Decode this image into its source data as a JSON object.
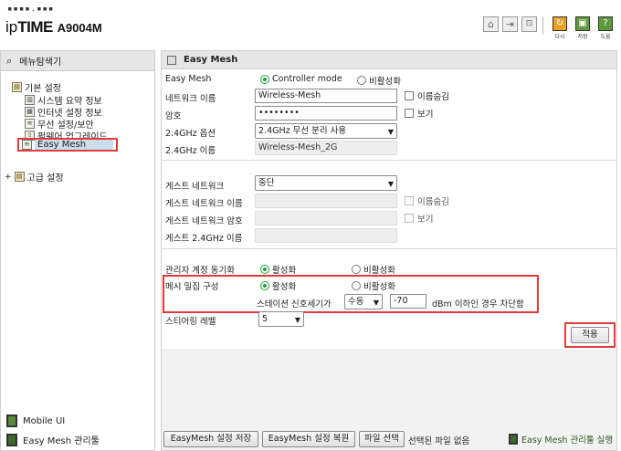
{
  "header": {
    "logo_dots": "▪▪▪▪.▪▪▪",
    "logo_prefix": "ip",
    "logo_brand": "TIME",
    "logo_model": "A9004M",
    "icons": [
      {
        "name": "home-icon",
        "glyph": "⌂"
      },
      {
        "name": "logout-icon",
        "glyph": "⇥"
      },
      {
        "name": "lock-icon",
        "glyph": "🔒"
      }
    ],
    "tools": [
      {
        "name": "reboot",
        "label": "다시",
        "color": "#e8a325",
        "glyph": "↻"
      },
      {
        "name": "save",
        "label": "저장",
        "color": "#5d9a3a",
        "glyph": "▣"
      },
      {
        "name": "help",
        "label": "도움",
        "color": "#5d9a3a",
        "glyph": "?"
      }
    ]
  },
  "sidebar": {
    "title": "메뉴탐색기",
    "basic_settings": "기본 설정",
    "items": [
      {
        "label": "시스템 요약 정보"
      },
      {
        "label": "인터넷 설정 정보"
      },
      {
        "label": "무선 설정/보안"
      },
      {
        "label": "펌웨어 업그레이드"
      },
      {
        "label": "Easy Mesh"
      }
    ],
    "advanced_settings": "고급 설정",
    "footer": {
      "mobile_ui": "Mobile UI",
      "easymesh_tool": "Easy Mesh 관리툴"
    }
  },
  "panel": {
    "title": "Easy Mesh",
    "fields": {
      "easymesh_label": "Easy Mesh",
      "controller_mode": "Controller mode",
      "disable": "비활성화",
      "network_name_label": "네트워크 이름",
      "network_name_value": "Wireless-Mesh",
      "hide_name": "이름숨김",
      "password_label": "암호",
      "password_value": "••••••••",
      "show": "보기",
      "ghz_option_label": "2.4GHz 옵션",
      "ghz_option_value": "2.4GHz 무선 분리 사용",
      "ghz_name_label": "2.4GHz 이름",
      "ghz_name_value": "Wireless-Mesh_2G",
      "guest_network_label": "게스트 네트워크",
      "guest_network_value": "중단",
      "guest_name_label": "게스트 네트워크 이름",
      "guest_pw_label": "게스트 네트워크 암호",
      "guest_ghz_name_label": "게스트 2.4GHz 이름",
      "admin_sync_label": "관리자 계정 동기화",
      "enable": "활성화",
      "mesh_density_label": "메시 밀집 구성",
      "station_signal_label": "스테이션 신호세기가",
      "manual_value": "수동",
      "signal_value": "-70",
      "signal_suffix": "dBm 이하인 경우 차단함",
      "steering_label": "스티어링 레벨",
      "steering_value": "5"
    },
    "apply_button": "적용"
  },
  "bottom": {
    "save_config": "EasyMesh 설정 저장",
    "restore_config": "EasyMesh 설정 복원",
    "file_select": "파일 선택",
    "no_file": "선택된 파일 없음",
    "run_tool": "Easy Mesh 관리툴 실행"
  }
}
